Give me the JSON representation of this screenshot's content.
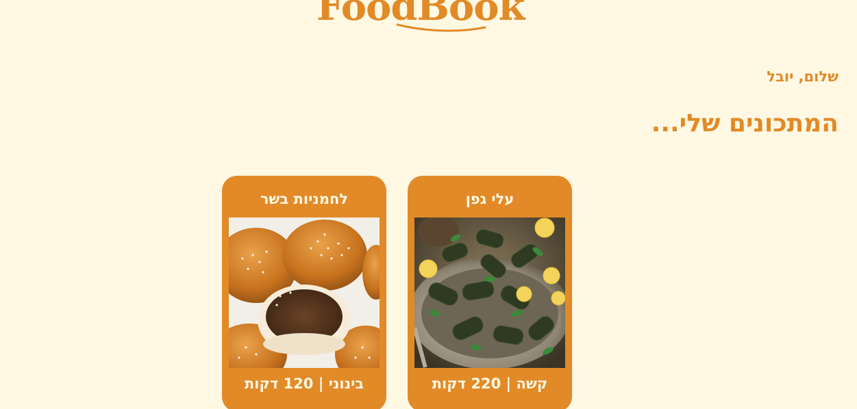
{
  "brand": {
    "logo_text": "FoodBook"
  },
  "greeting": "שלום, יובל",
  "section_title": "המתכונים שלי...",
  "colors": {
    "background": "#fff8e3",
    "accent": "#e28a26",
    "card_text": "#fff8e3"
  },
  "recipes": [
    {
      "title": "עלי גפן",
      "image": "stuffed-grape-leaves-photo",
      "difficulty": "קשה",
      "separator": "|",
      "time": "220 דקות"
    },
    {
      "title": "לחמניות בשר",
      "image": "meat-buns-photo",
      "difficulty": "בינוני",
      "separator": "|",
      "time": "120 דקות"
    }
  ]
}
